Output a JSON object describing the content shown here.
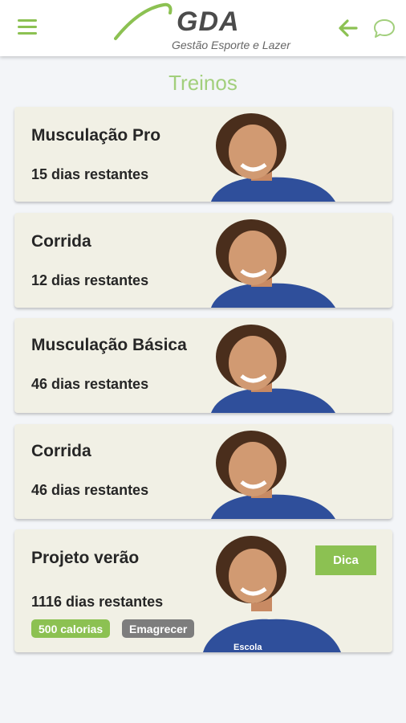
{
  "header": {
    "logo_name": "GDA",
    "logo_tagline": "Gestão Esporte e Lazer",
    "accent_color": "#8cc152",
    "menu_icon": "hamburger-menu-icon",
    "back_icon": "arrow-left-icon",
    "chat_icon": "chat-bubble-icon"
  },
  "page": {
    "title": "Treinos"
  },
  "cards": [
    {
      "title": "Musculação Pro",
      "remaining": "15 dias restantes"
    },
    {
      "title": "Corrida",
      "remaining": "12 dias restantes"
    },
    {
      "title": "Musculação Básica",
      "remaining": "46 dias restantes"
    },
    {
      "title": "Corrida",
      "remaining": "46 dias restantes"
    },
    {
      "title": "Projeto verão",
      "remaining": "1116 dias restantes",
      "tip_label": "Dica",
      "badges": [
        {
          "label": "500 calorias",
          "color": "#8cc152"
        },
        {
          "label": "Emagrecer",
          "color": "#7d7d7d"
        }
      ],
      "shirt_text": "Escola"
    }
  ]
}
